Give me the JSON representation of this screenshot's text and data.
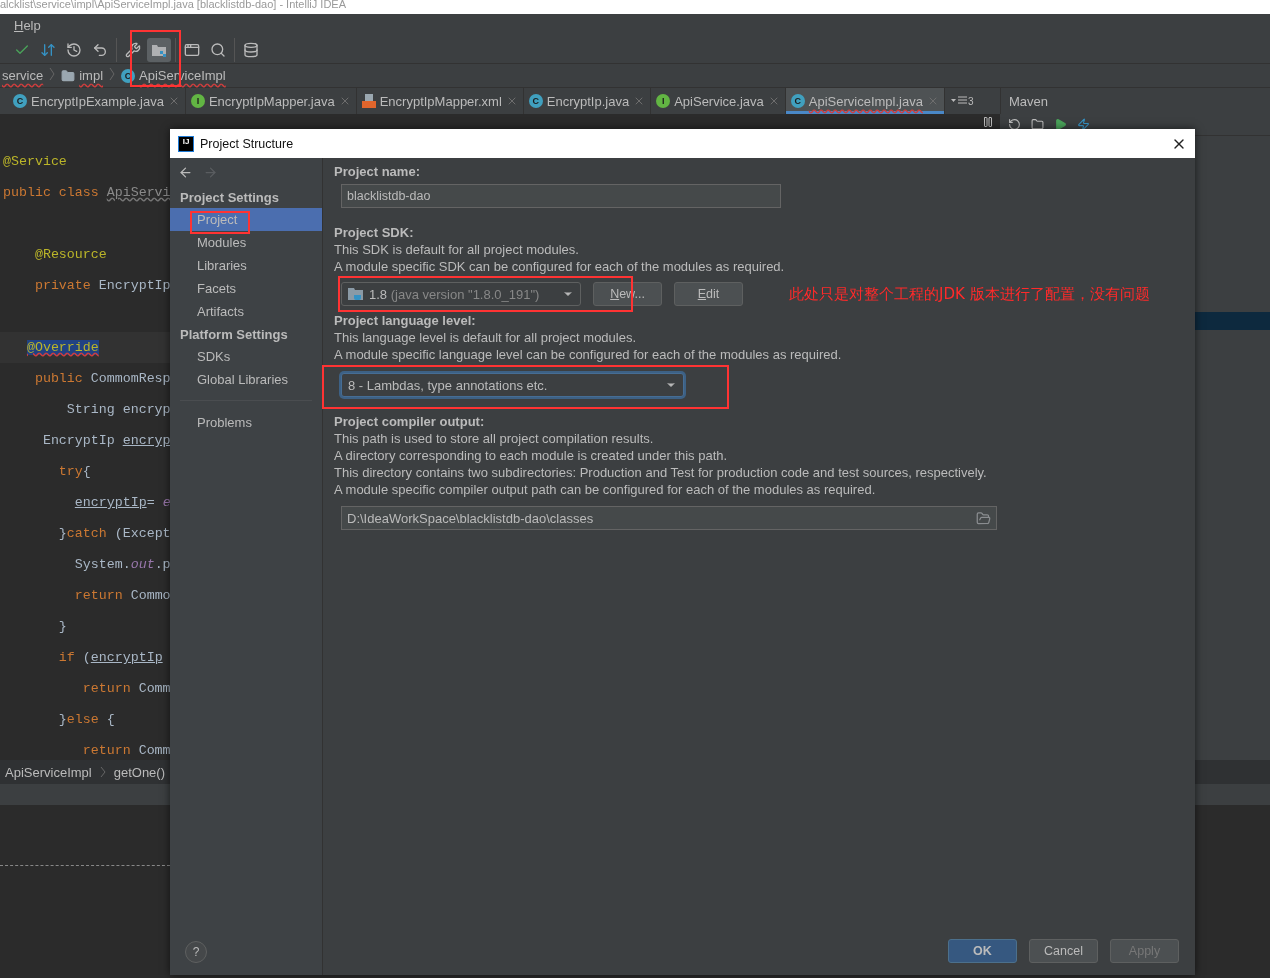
{
  "window": {
    "title": "alcklist\\service\\impl\\ApiServiceImpl.java [blacklistdb-dao] - IntelliJ IDEA"
  },
  "menu": [
    {
      "label": "Help"
    }
  ],
  "toolbar_groups": [
    {
      "buttons": [
        {
          "kind": "commit",
          "selected": false
        },
        {
          "kind": "update",
          "selected": false
        },
        {
          "kind": "history",
          "selected": false
        },
        {
          "kind": "rollback",
          "selected": false
        }
      ]
    },
    {
      "buttons": [
        {
          "kind": "build",
          "selected": false
        },
        {
          "kind": "structure",
          "selected": true
        }
      ]
    },
    {
      "buttons": [
        {
          "kind": "terminal",
          "selected": false
        },
        {
          "kind": "search",
          "selected": false
        }
      ]
    },
    {
      "buttons": [
        {
          "kind": "database",
          "selected": false
        }
      ]
    }
  ],
  "breadcrumbs": [
    {
      "label": "service",
      "kind": "package",
      "error": true
    },
    {
      "label": "impl",
      "kind": "folder",
      "error": true
    },
    {
      "label": "ApiServiceImpl",
      "kind": "class",
      "badge": "C",
      "error": true
    }
  ],
  "tabs": [
    {
      "label": "EncryptIpExample.java",
      "kind": "class",
      "badge": "C",
      "selected": false
    },
    {
      "label": "EncryptIpMapper.java",
      "kind": "interface",
      "badge": "I",
      "selected": false
    },
    {
      "label": "EncryptIpMapper.xml",
      "kind": "xml",
      "selected": false
    },
    {
      "label": "EncryptIp.java",
      "kind": "class",
      "badge": "C",
      "selected": false
    },
    {
      "label": "ApiService.java",
      "kind": "interface",
      "badge": "I",
      "selected": false
    },
    {
      "label": "ApiServiceImpl.java",
      "kind": "class",
      "badge": "C",
      "selected": true
    }
  ],
  "tab_overflow": "3",
  "tool_window": {
    "title": "Maven"
  },
  "editor": {
    "lines": [
      {
        "kind": "code",
        "selected": false,
        "tokens": [
          {
            "text": "@Service",
            "kind": "annotation"
          }
        ]
      },
      {
        "kind": "code",
        "selected": false,
        "tokens": [
          {
            "text": "public class ",
            "kind": "keyword"
          },
          {
            "text": "ApiServi",
            "kind": "unused"
          }
        ]
      },
      {
        "kind": "blank"
      },
      {
        "kind": "code",
        "selected": false,
        "tokens": [
          {
            "text": "    @Resource",
            "kind": "annotation"
          }
        ]
      },
      {
        "kind": "code",
        "selected": false,
        "tokens": [
          {
            "text": "    private ",
            "kind": "keyword"
          },
          {
            "text": "EncryptIp",
            "kind": "plain"
          }
        ]
      },
      {
        "kind": "blank"
      },
      {
        "kind": "code",
        "selected": true,
        "tokens": [
          {
            "text": "   @Override",
            "kind": "error"
          }
        ]
      },
      {
        "kind": "code",
        "selected": false,
        "tokens": [
          {
            "text": "    public ",
            "kind": "keyword"
          },
          {
            "text": "CommomResp",
            "kind": "plain"
          }
        ]
      },
      {
        "kind": "code",
        "selected": false,
        "tokens": [
          {
            "text": "        String encryp",
            "kind": "plain"
          }
        ]
      },
      {
        "kind": "code",
        "selected": false,
        "tokens": [
          {
            "text": "     EncryptIp ",
            "kind": "plain"
          },
          {
            "text": "encryp",
            "kind": "ref"
          }
        ]
      },
      {
        "kind": "code",
        "selected": false,
        "tokens": [
          {
            "text": "       try",
            "kind": "keyword"
          },
          {
            "text": "{",
            "kind": "plain"
          }
        ]
      },
      {
        "kind": "code",
        "selected": false,
        "tokens": [
          {
            "text": "         encryptIp",
            "kind": "ref"
          },
          {
            "text": "= ",
            "kind": "plain"
          },
          {
            "text": "e",
            "kind": "field"
          }
        ]
      },
      {
        "kind": "code",
        "selected": false,
        "tokens": [
          {
            "text": "       }",
            "kind": "plain"
          },
          {
            "text": "catch ",
            "kind": "keyword"
          },
          {
            "text": "(Except",
            "kind": "plain"
          }
        ]
      },
      {
        "kind": "code",
        "selected": false,
        "tokens": [
          {
            "text": "         System.",
            "kind": "plain"
          },
          {
            "text": "out",
            "kind": "field"
          },
          {
            "text": ".p",
            "kind": "plain"
          }
        ]
      },
      {
        "kind": "code",
        "selected": false,
        "tokens": [
          {
            "text": "         return ",
            "kind": "keyword"
          },
          {
            "text": "Commo",
            "kind": "plain"
          }
        ]
      },
      {
        "kind": "code",
        "selected": false,
        "tokens": [
          {
            "text": "       }",
            "kind": "plain"
          }
        ]
      },
      {
        "kind": "code",
        "selected": false,
        "tokens": [
          {
            "text": "       if ",
            "kind": "keyword"
          },
          {
            "text": "(",
            "kind": "plain"
          },
          {
            "text": "encryptIp",
            "kind": "ref"
          }
        ]
      },
      {
        "kind": "code",
        "selected": false,
        "tokens": [
          {
            "text": "          return ",
            "kind": "keyword"
          },
          {
            "text": "Comm",
            "kind": "plain"
          }
        ]
      },
      {
        "kind": "code",
        "selected": false,
        "tokens": [
          {
            "text": "       }",
            "kind": "plain"
          },
          {
            "text": "else ",
            "kind": "keyword"
          },
          {
            "text": "{",
            "kind": "plain"
          }
        ]
      },
      {
        "kind": "code",
        "selected": false,
        "tokens": [
          {
            "text": "          return ",
            "kind": "keyword"
          },
          {
            "text": "Comm",
            "kind": "plain"
          }
        ]
      }
    ],
    "breadcrumbs": [
      "ApiServiceImpl",
      "getOne()"
    ]
  },
  "dialog": {
    "title": "Project Structure",
    "logo": "IJ",
    "sidebar": [
      {
        "heading": "Project Settings",
        "items": [
          {
            "label": "Project",
            "selected": true
          },
          {
            "label": "Modules",
            "selected": false
          },
          {
            "label": "Libraries",
            "selected": false
          },
          {
            "label": "Facets",
            "selected": false
          },
          {
            "label": "Artifacts",
            "selected": false
          }
        ]
      },
      {
        "heading": "Platform Settings",
        "items": [
          {
            "label": "SDKs",
            "selected": false
          },
          {
            "label": "Global Libraries",
            "selected": false
          }
        ]
      }
    ],
    "sidebar_extra": [
      {
        "label": "Problems",
        "selected": false
      }
    ],
    "help": "?",
    "project_name": {
      "label": "Project name:",
      "value": "blacklistdb-dao"
    },
    "sdk": {
      "label": "Project SDK:",
      "lines": [
        "This SDK is default for all project modules.",
        "A module specific SDK can be configured for each of the modules as required."
      ],
      "version": "1.8",
      "detail": "(java version \"1.8.0_191\")",
      "buttons": [
        {
          "label": "New..."
        },
        {
          "label": "Edit"
        }
      ]
    },
    "annotation": "此处只是对整个工程的JDK 版本进行了配置，没有问题",
    "language_level": {
      "label": "Project language level:",
      "lines": [
        "This language level is default for all project modules.",
        "A module specific language level can be configured for each of the modules as required."
      ],
      "value": "8 - Lambdas, type annotations etc.",
      "focused": true
    },
    "compiler_output": {
      "label": "Project compiler output:",
      "lines": [
        "This path is used to store all project compilation results.",
        "A directory corresponding to each module is created under this path.",
        "This directory contains two subdirectories: Production and Test for production code and test sources, respectively.",
        "A module specific compiler output path can be configured for each of the modules as required."
      ],
      "value": "D:\\IdeaWorkSpace\\blacklistdb-dao\\classes"
    },
    "buttons": [
      {
        "label": "OK",
        "kind": "primary",
        "disabled": false
      },
      {
        "label": "Cancel",
        "kind": "normal",
        "disabled": false
      },
      {
        "label": "Apply",
        "kind": "normal",
        "disabled": true
      }
    ]
  }
}
